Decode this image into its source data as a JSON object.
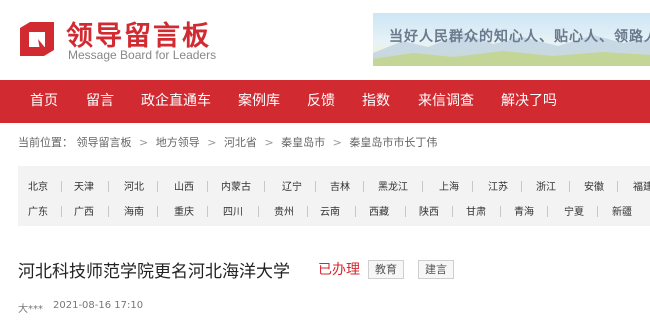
{
  "header": {
    "logo_cn": "领导留言板",
    "logo_en": "Message Board for Leaders",
    "banner_text": "当好人民群众的知心人、贴心人、领路人，"
  },
  "nav": [
    "首页",
    "留言",
    "政企直通车",
    "案例库",
    "反馈",
    "指数",
    "来信调查",
    "解决了吗"
  ],
  "breadcrumb": {
    "prefix": "当前位置：",
    "items": [
      "领导留言板",
      "地方领导",
      "河北省",
      "秦皇岛市",
      "秦皇岛市市长丁伟"
    ],
    "separator": ">"
  },
  "provinces": {
    "row1": [
      "北京",
      "天津",
      "河北",
      "山西",
      "内蒙古",
      "辽宁",
      "吉林",
      "黑龙江",
      "上海",
      "江苏",
      "浙江",
      "安徽",
      "福建"
    ],
    "row2": [
      "广东",
      "广西",
      "海南",
      "重庆",
      "四川",
      "贵州",
      "云南",
      "西藏",
      "陕西",
      "甘肃",
      "青海",
      "宁夏",
      "新疆"
    ]
  },
  "message": {
    "title": "河北科技师范学院更名河北海洋大学",
    "status": "已办理",
    "tags": [
      "教育",
      "建言"
    ],
    "author": "大***",
    "date": "2021-08-16 17:10"
  },
  "colors": {
    "brand_red": "#d22a31"
  }
}
